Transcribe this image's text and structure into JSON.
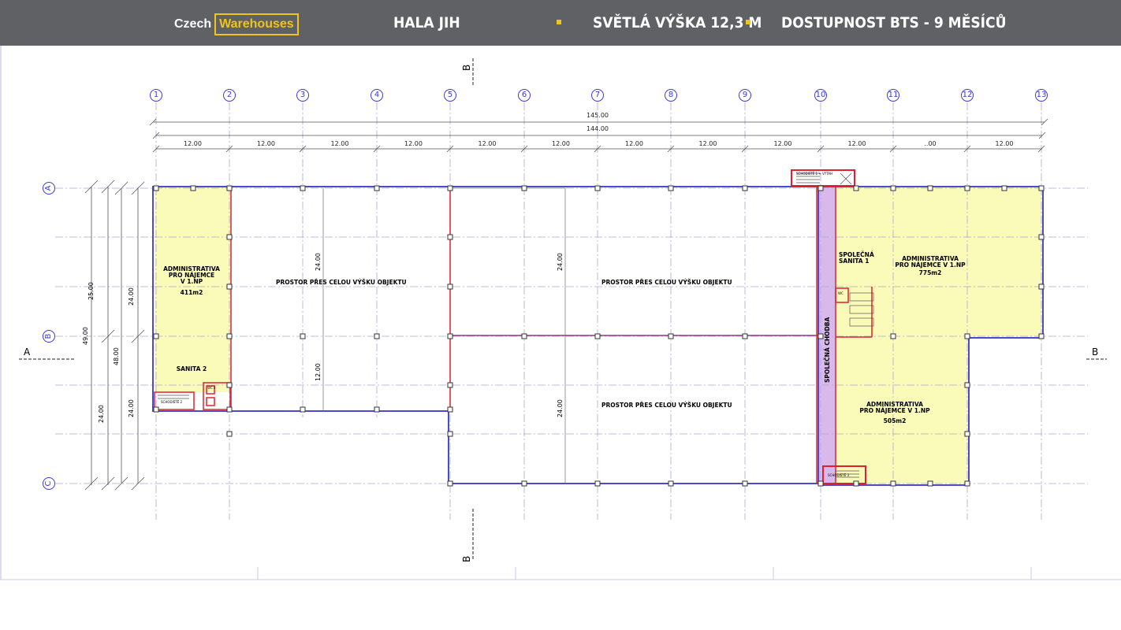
{
  "header": {
    "logo_part1": "Czech",
    "logo_part2": "Warehouses",
    "hall_name": "HALA JIH",
    "clear_height": "SVĚTLÁ VÝŠKA 12,3 M",
    "availability": "DOSTUPNOST BTS - 9 MĚSÍCŮ",
    "accent_color": "#f0c419",
    "bar_color": "#5f6164"
  },
  "plan": {
    "column_axes": [
      "1",
      "2",
      "3",
      "4",
      "5",
      "6",
      "7",
      "8",
      "9",
      "10",
      "11",
      "12",
      "13"
    ],
    "row_axes": [
      "A",
      "B",
      "C"
    ],
    "dim_total_outer": "145.00",
    "dim_total_inner": "144.00",
    "bay_dims": [
      "12.00",
      "12.00",
      "12.00",
      "12.00",
      "12.00",
      "12.00",
      "12.00",
      "12.00",
      "12.00",
      "12.00",
      "..00",
      "12.00"
    ],
    "left_dims": {
      "d25": "25.00",
      "d24a": "24.00",
      "d49": "49.00",
      "d48": "48.00",
      "d24b": "24.00",
      "d24c": "24.00"
    },
    "inner_dims": {
      "d24_1": "24.00",
      "d12": "12.00",
      "d24_2": "24.00",
      "d24_3": "24.00"
    },
    "section_marks": {
      "a_left": "A",
      "a_right": "B",
      "b_top": "B",
      "b_bottom": "B"
    },
    "rooms": {
      "admin_left_l1": "ADMINISTRATIVA",
      "admin_left_l2": "PRO NÁJEMCE",
      "admin_left_l3": "V 1.NP",
      "admin_left_area": "411m2",
      "sanita2": "SANITA 2",
      "space1": "PROSTOR PŘES CELOU VÝŠKU OBJEKTU",
      "space2": "PROSTOR PŘES CELOU VÝŠKU OBJEKTU",
      "space3": "PROSTOR PŘES CELOU VÝŠKU OBJEKTU",
      "corridor": "SPOLEČNÁ CHODBA",
      "sanita1_l1": "SPOLEČNÁ",
      "sanita1_l2": "SANITA 1",
      "admin_ne_l1": "ADMINISTRATIVA",
      "admin_ne_l2": "PRO NÁJEMCE V 1.NP",
      "admin_ne_area": "775m2",
      "admin_se_l1": "ADMINISTRATIVA",
      "admin_se_l2": "PRO NÁJEMCE V 1.NP",
      "admin_se_area": "505m2",
      "stair_top": "SCHODIŠTĚ 1 + VÝTAH",
      "stair_bottom": "SCHODIŠTĚ 3",
      "stair_left": "SCHODIŠTĚ 2",
      "wc1": "WC",
      "wc2": "WC 2"
    }
  }
}
